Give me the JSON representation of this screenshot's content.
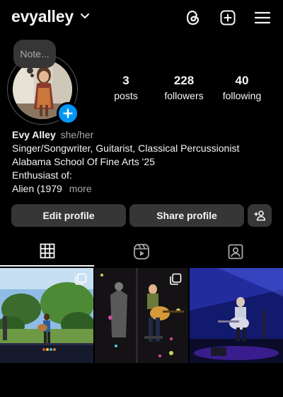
{
  "header": {
    "username": "evyalley",
    "icons": [
      "chevron-down-icon",
      "threads-icon",
      "add-square-icon",
      "hamburger-menu-icon"
    ]
  },
  "profile": {
    "note_placeholder": "Note...",
    "avatar_badge_icon": "plus-icon",
    "stats": [
      {
        "value": "3",
        "label": "posts"
      },
      {
        "value": "228",
        "label": "followers"
      },
      {
        "value": "40",
        "label": "following"
      }
    ]
  },
  "bio": {
    "name": "Evy Alley",
    "pronouns": "she/her",
    "lines": [
      "Singer/Songwriter, Guitarist, Classical Percussionist",
      "Alabama School Of Fine Arts '25",
      "Enthusiast of:",
      "Alien (1979"
    ],
    "more_label": "more"
  },
  "actions": {
    "edit_label": "Edit profile",
    "share_label": "Share profile",
    "add_user_icon": "add-person-icon"
  },
  "tabs": [
    {
      "icon": "grid-icon",
      "active": true
    },
    {
      "icon": "reels-icon",
      "active": false
    },
    {
      "icon": "tagged-icon",
      "active": false
    }
  ],
  "colors": {
    "background": "#000000",
    "button": "#363636",
    "accent_blue": "#0095f6",
    "secondary_text": "#a8a8a8"
  },
  "posts": [
    {
      "type": "carousel",
      "scene": "outdoor stage performer with guitar under trees"
    },
    {
      "type": "carousel",
      "scene": "indoor performer on stool with acoustic guitar"
    },
    {
      "type": "single",
      "scene": "performer with guitar under blue stage lights"
    }
  ]
}
